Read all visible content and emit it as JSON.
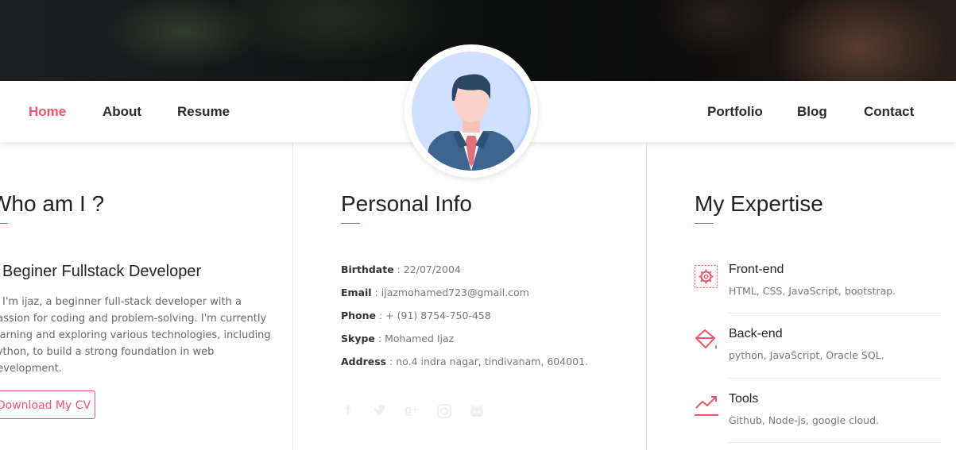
{
  "nav": {
    "left": [
      {
        "label": "Home",
        "active": true
      },
      {
        "label": "About",
        "active": false
      },
      {
        "label": "Resume",
        "active": false
      }
    ],
    "right": [
      {
        "label": "Portfolio"
      },
      {
        "label": "Blog"
      },
      {
        "label": "Contact"
      }
    ]
  },
  "about": {
    "title": "Who am I ?",
    "subtitle": "Beginer Fullstack Developer",
    "bio_lines": [
      "I'm ijaz, a beginner full-stack developer with a",
      "passion for coding and problem-solving. I'm currently",
      "learning and exploring various technologies, including",
      "Python, to build a strong foundation in web",
      "development."
    ],
    "cv_button": "Download My CV"
  },
  "personal": {
    "title": "Personal Info",
    "rows": [
      {
        "label": "Birthdate",
        "value": "22/07/2004"
      },
      {
        "label": "Email",
        "value": "ijazmohamed723@gmail.com"
      },
      {
        "label": "Phone",
        "value": "+ (91) 8754-750-458"
      },
      {
        "label": "Skype",
        "value": "Mohamed Ijaz"
      },
      {
        "label": "Address",
        "value": "no.4 indra nagar, tindivanam, 604001."
      }
    ],
    "social_icons": [
      "facebook-icon",
      "twitter-icon",
      "google-plus-icon",
      "instagram-icon",
      "github-icon"
    ]
  },
  "expertise": {
    "title": "My Expertise",
    "items": [
      {
        "title": "Front-end",
        "desc": "HTML, CSS, JavaScript, bootstrap.",
        "icon": "gear-icon"
      },
      {
        "title": "Back-end",
        "desc": "python, JavaScript, Oracle SQL.",
        "icon": "paint-bucket-icon"
      },
      {
        "title": "Tools",
        "desc": "Github, Node-js, google cloud.",
        "icon": "trending-up-icon"
      }
    ]
  },
  "colors": {
    "accent": "#e8566b",
    "text": "#222222",
    "muted": "#777777"
  }
}
